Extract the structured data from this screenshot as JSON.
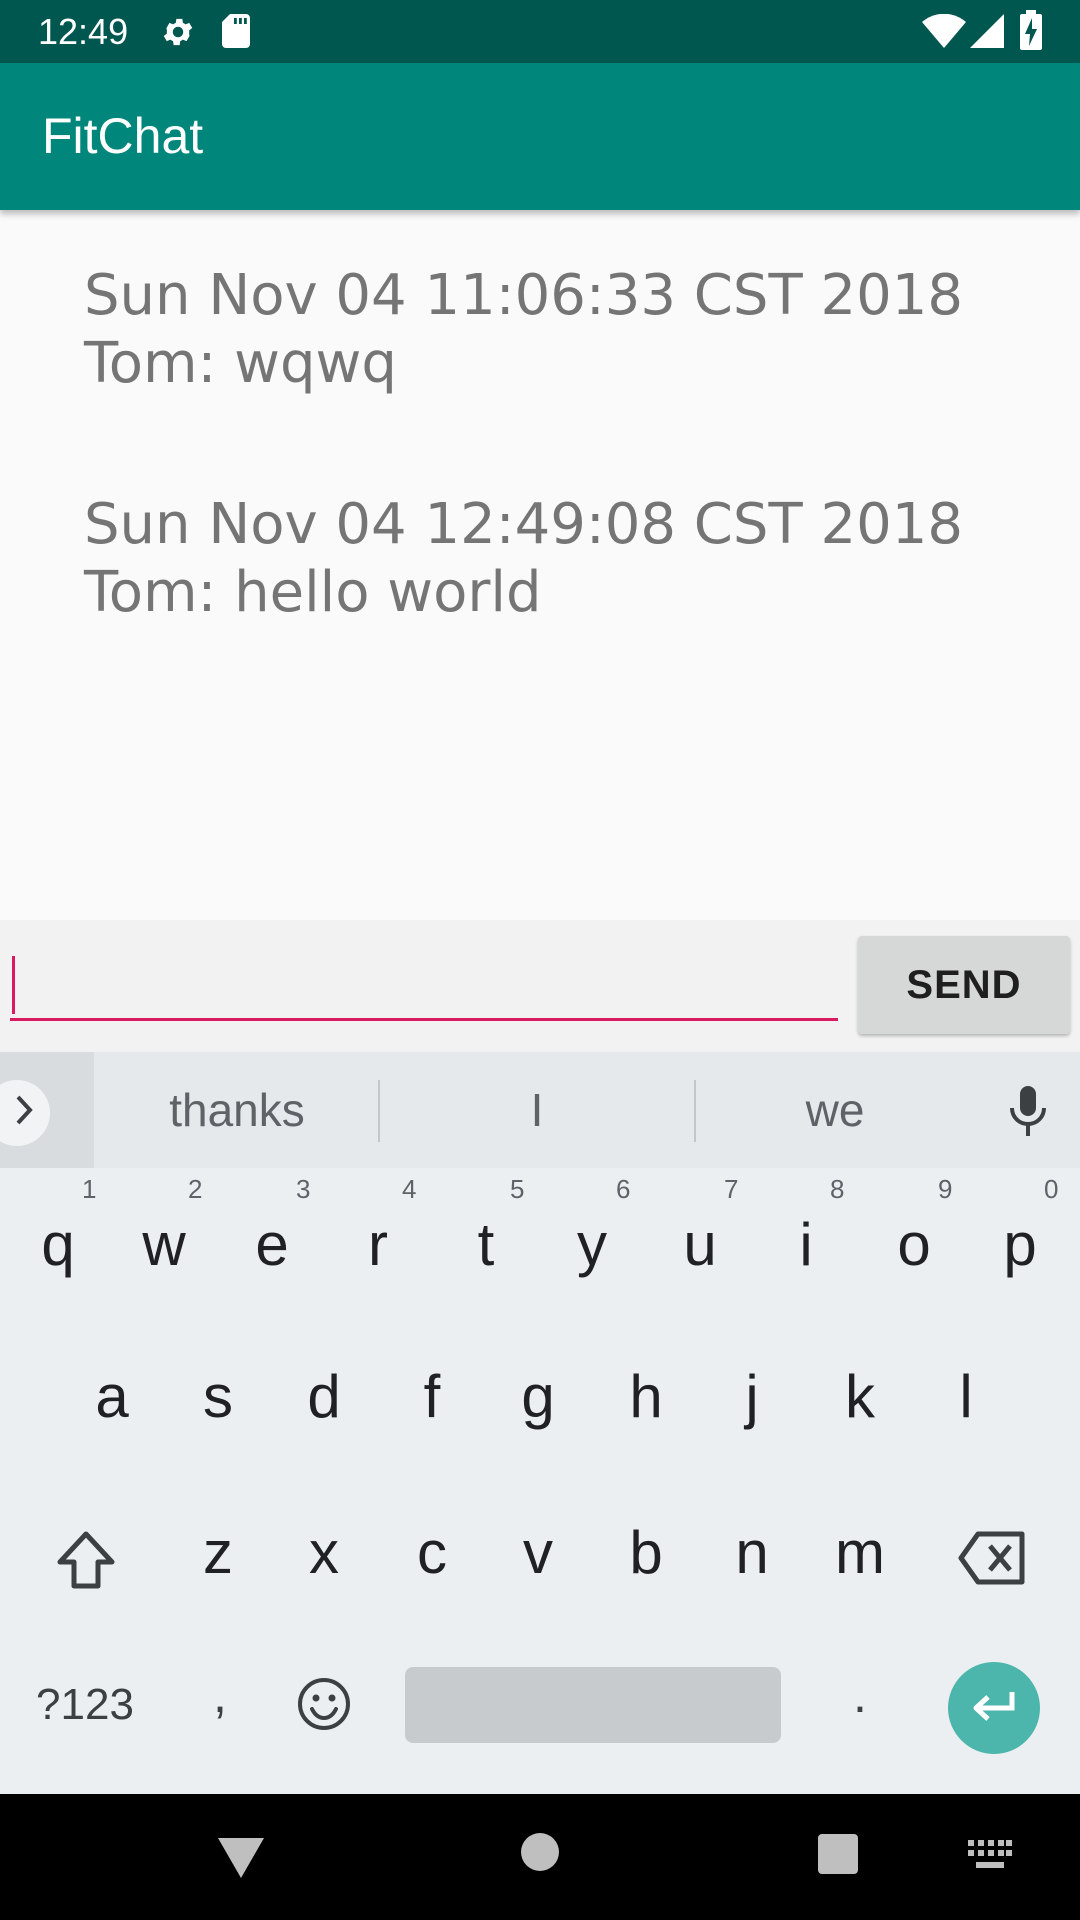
{
  "status_bar": {
    "time": "12:49",
    "icons": [
      "gear-icon",
      "sd-card-icon",
      "wifi-icon",
      "signal-icon",
      "battery-icon"
    ]
  },
  "app_bar": {
    "title": "FitChat"
  },
  "messages": [
    {
      "timestamp": "Sun Nov 04 11:06:33 CST 2018",
      "text": "Tom: wqwq"
    },
    {
      "timestamp": "Sun Nov 04 12:49:08 CST 2018",
      "text": "Tom: hello world"
    }
  ],
  "compose": {
    "input_value": "",
    "send_label": "SEND"
  },
  "keyboard": {
    "suggestions": [
      "thanks",
      "I",
      "we"
    ],
    "row1": [
      "q",
      "w",
      "e",
      "r",
      "t",
      "y",
      "u",
      "i",
      "o",
      "p"
    ],
    "row1_hints": [
      "1",
      "2",
      "3",
      "4",
      "5",
      "6",
      "7",
      "8",
      "9",
      "0"
    ],
    "row2": [
      "a",
      "s",
      "d",
      "f",
      "g",
      "h",
      "j",
      "k",
      "l"
    ],
    "row3": [
      "z",
      "x",
      "c",
      "v",
      "b",
      "n",
      "m"
    ],
    "symbols_label": "?123",
    "comma": ",",
    "period": "."
  },
  "colors": {
    "status_bar": "#00574f",
    "app_bar": "#00867a",
    "accent": "#d81b60",
    "enter_key": "#4db6ac"
  }
}
